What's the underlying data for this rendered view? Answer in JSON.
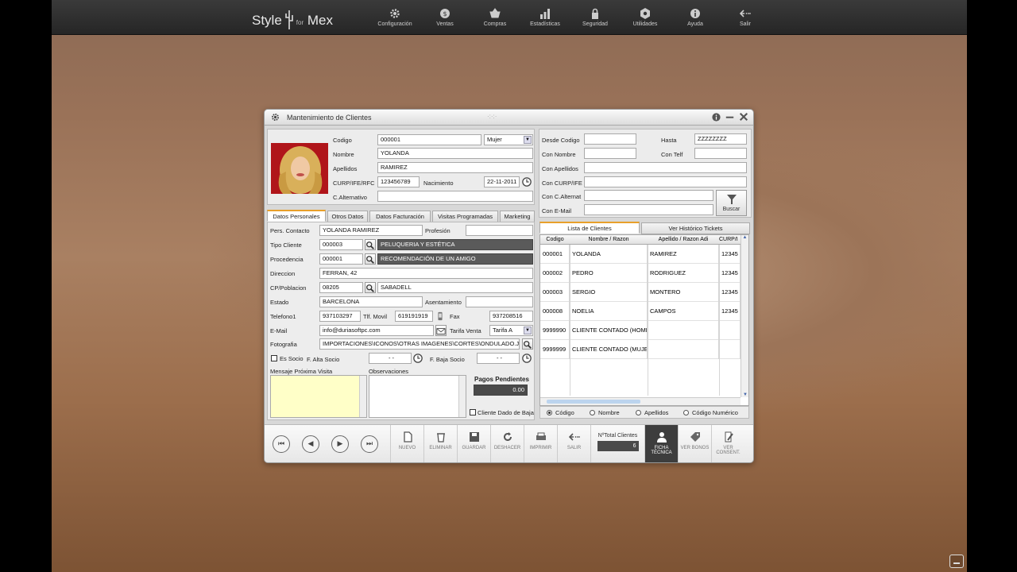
{
  "app": {
    "logo_left": "Style",
    "logo_small": "for",
    "logo_right": "Mex"
  },
  "menu": [
    {
      "label": "Configuración",
      "icon": "gear-icon"
    },
    {
      "label": "Ventas",
      "icon": "dollar-icon"
    },
    {
      "label": "Compras",
      "icon": "basket-icon"
    },
    {
      "label": "Estadísticas",
      "icon": "bar-chart-icon"
    },
    {
      "label": "Seguridad",
      "icon": "lock-icon"
    },
    {
      "label": "Utilidades",
      "icon": "settings-icon"
    },
    {
      "label": "Ayuda",
      "icon": "info-icon"
    },
    {
      "label": "Salir",
      "icon": "exit-icon"
    }
  ],
  "window": {
    "title": "Mantenimiento de Clientes"
  },
  "client": {
    "codigo_label": "Codigo",
    "codigo": "000001",
    "genero": "Mujer",
    "nombre_label": "Nombre",
    "nombre": "YOLANDA",
    "apellidos_label": "Apellidos",
    "apellidos": "RAMIREZ",
    "curp_label": "CURP/IFE/RFC",
    "curp": "123456789",
    "nacimiento_label": "Nacimiento",
    "nacimiento": "22-11-2011",
    "alt_label": "C.Alternativo",
    "alt": ""
  },
  "tabs": [
    "Datos Personales",
    "Otros Datos",
    "Datos Facturación",
    "Visitas Programadas",
    "Marketing"
  ],
  "personal": {
    "contacto_label": "Pers. Contacto",
    "contacto": "YOLANDA RAMIREZ",
    "profesion_label": "Profesión",
    "profesion": "",
    "tipo_label": "Tipo Cliente",
    "tipo_code": "000003",
    "tipo_desc": "PELUQUERIA Y ESTÉTICA",
    "proc_label": "Procedencia",
    "proc_code": "000001",
    "proc_desc": "RECOMENDACIÓN DE UN AMIGO",
    "dir_label": "Direccion",
    "dir": "FERRAN, 42",
    "cp_label": "CP/Poblacion",
    "cp": "08205",
    "poblacion": "SABADELL",
    "estado_label": "Estado",
    "estado": "BARCELONA",
    "asent_label": "Asentamiento",
    "asent": "",
    "tel_label": "Telefono1",
    "tel": "937103297",
    "movil_label": "Tlf. Movil",
    "movil": "619191919",
    "fax_label": "Fax",
    "fax": "937208516",
    "email_label": "E-Mail",
    "email": "info@duriasoftpc.com",
    "tarifa_label": "Tarifa Venta",
    "tarifa": "Tarifa A",
    "foto_label": "Fotografia",
    "foto": "IMPORTACIONES\\ICONOS\\OTRAS IMAGENES\\CORTES\\ONDULADO.JPG",
    "socio_label": "Es Socio",
    "alta_label": "F. Alta Socio",
    "alta": "- -",
    "baja_label": "F. Baja Socio",
    "baja": "- -",
    "msg_label": "Mensaje Próxima Visita",
    "obs_label": "Observaciones",
    "pagos_label": "Pagos Pendientes",
    "pagos": "0.00",
    "dado_baja_label": "Cliente Dado de Baja"
  },
  "filters": {
    "desde_label": "Desde Codigo",
    "desde": "",
    "hasta_label": "Hasta",
    "hasta": "ZZZZZZZZ",
    "con_nombre_label": "Con Nombre",
    "con_telf_label": "Con Telf",
    "con_apellidos_label": "Con Apellidos",
    "con_curp_label": "Con CURP/IFE",
    "con_alt_label": "Con C.Alternat",
    "con_email_label": "Con E-Mail",
    "buscar_label": "Buscar"
  },
  "list_tabs": [
    "Lista de Clientes",
    "Ver Histórico Tickets"
  ],
  "table": {
    "headers": [
      "Codigo",
      "Nombre / Razon",
      "Apellido / Razon Adi",
      "CURP/I"
    ],
    "rows": [
      [
        "000001",
        "YOLANDA",
        "RAMIREZ",
        "12345"
      ],
      [
        "000002",
        "PEDRO",
        "RODRIGUEZ",
        "12345"
      ],
      [
        "000003",
        "SERGIO",
        "MONTERO",
        "12345"
      ],
      [
        "000008",
        "NOELIA",
        "CAMPOS",
        "12345"
      ],
      [
        "9999990",
        "CLIENTE CONTADO (HOMBR",
        "",
        ""
      ],
      [
        "9999999",
        "CLIENTE CONTADO (MUJER)",
        "",
        ""
      ]
    ]
  },
  "sort": [
    "Código",
    "Nombre",
    "Apellidos",
    "Código Numérico"
  ],
  "toolbar": {
    "nuevo": "NUEVO",
    "eliminar": "ELIMINAR",
    "guardar": "GUARDAR",
    "deshacer": "DESHACER",
    "imprimir": "IMPRIMIR",
    "salir": "SALIR",
    "total_label": "NºTotal Clientes",
    "total": "6",
    "ficha": "FICHA TÉCNICA",
    "bonos": "VER BONOS",
    "consent": "VER CONSENT."
  }
}
